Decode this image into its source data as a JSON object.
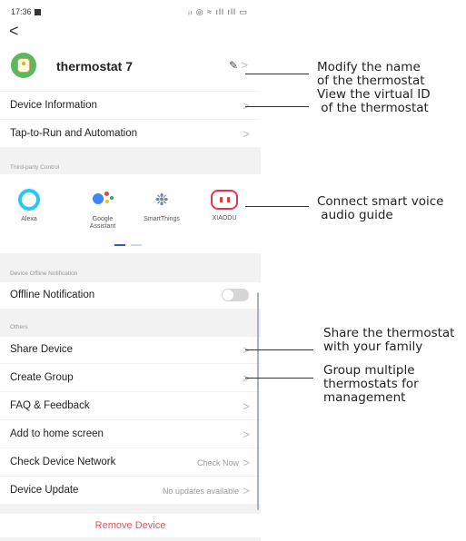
{
  "status_bar": {
    "time": "17:36",
    "icons": "ᵢₗ ◎ ≈ ıll ıll ▭"
  },
  "nav": {
    "back_glyph": "<"
  },
  "device": {
    "name": "thermostat 7",
    "edit_glyph": "✎"
  },
  "menu_top": [
    {
      "label": "Device Information"
    },
    {
      "label": "Tap-to-Run and Automation"
    }
  ],
  "third_party": {
    "section_title": "Third-party Control",
    "services": [
      {
        "name": "Alexa",
        "icon": "alexa-icon"
      },
      {
        "name": "Google\nAssistant",
        "icon": "google-assistant-icon"
      },
      {
        "name": "SmartThings",
        "icon": "smartthings-icon"
      },
      {
        "name": "XIAODU",
        "icon": "xiaodu-icon"
      }
    ]
  },
  "offline": {
    "section_title": "Device Offline Notification",
    "label": "Offline Notification",
    "enabled": false
  },
  "others": {
    "section_title": "Others",
    "items": [
      {
        "label": "Share Device",
        "value": ""
      },
      {
        "label": "Create Group",
        "value": ""
      },
      {
        "label": "FAQ & Feedback",
        "value": ""
      },
      {
        "label": "Add to home screen",
        "value": ""
      },
      {
        "label": "Check Device Network",
        "value": "Check Now"
      },
      {
        "label": "Device Update",
        "value": "No updates available"
      }
    ]
  },
  "remove_label": "Remove Device",
  "chevron": ">",
  "colors": {
    "accent": "#e0555a",
    "icon_green": "#5cb85c",
    "alexa": "#27c8f2",
    "xiaodu": "#e5354b"
  },
  "annotations": {
    "modify_name": [
      "Modify the name",
      "of the thermostat"
    ],
    "virtual_id": [
      "View the virtual ID",
      " of the thermostat"
    ],
    "voice": [
      "Connect smart voice",
      " audio guide"
    ],
    "share": [
      "Share the thermostat",
      "with your family"
    ],
    "group": [
      "Group multiple",
      "thermostats for",
      "management"
    ]
  }
}
